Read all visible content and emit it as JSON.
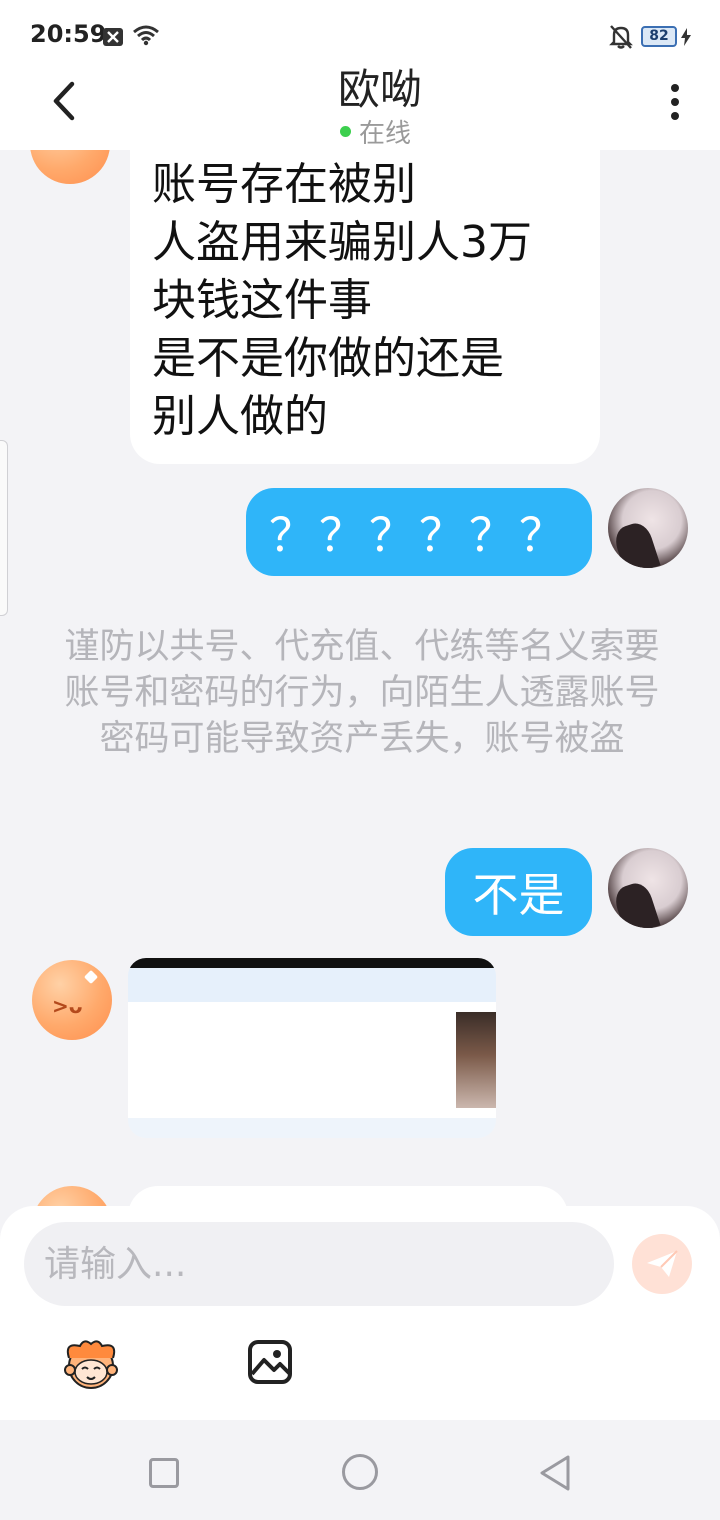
{
  "status_bar": {
    "time": "20:59",
    "battery": "82",
    "icons": [
      "notification-x-icon",
      "wifi-icon",
      "bell-muted-icon",
      "battery-icon",
      "charging-icon"
    ]
  },
  "header": {
    "title": "欧呦",
    "status": "在线",
    "status_color": "#3ccf4e",
    "back_icon": "chevron-left-icon",
    "more_icon": "more-vertical-icon"
  },
  "messages": {
    "m1": {
      "from": "contact",
      "lines": [
        "账号存在被别",
        "人盗用来骗别人3万",
        "块钱这件事",
        "是不是你做的还是",
        "别人做的"
      ]
    },
    "m2": {
      "from": "me",
      "text": "？？？？？？"
    },
    "notice": "谨防以共号、代充值、代练等名义索要账号和密码的行为，向陌生人透露账号密码可能导致资产丢失，账号被盗",
    "m3": {
      "from": "me",
      "text": "不是"
    },
    "m4": {
      "from": "contact",
      "type": "image"
    }
  },
  "composer": {
    "placeholder": "请输入...",
    "send_icon": "send-icon",
    "emoji_icon": "emoji-icon",
    "image_icon": "image-icon"
  },
  "colors": {
    "accent_bubble": "#2fb5f9",
    "send_button": "#ffe1d6",
    "background": "#f3f3f6"
  }
}
